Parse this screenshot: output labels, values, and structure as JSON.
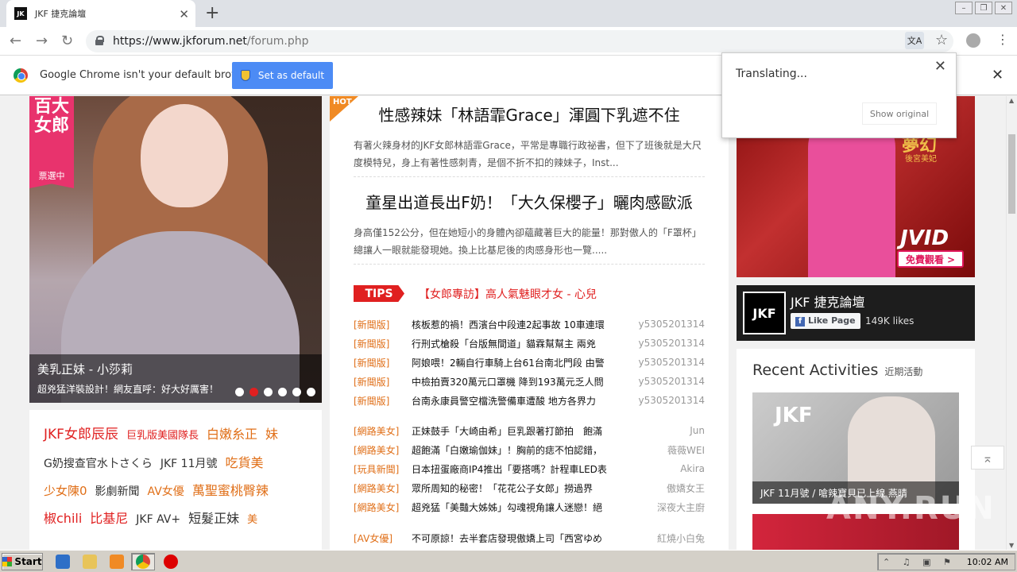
{
  "browser": {
    "tab_title": "JKF 捷克論壇",
    "favicon_text": "JK",
    "url_host": "https://www.jkforum.net",
    "url_path": "/forum.php",
    "infobar_text": "Google Chrome isn't your default browser",
    "set_default_label": "Set as default"
  },
  "translate_popup": {
    "status": "Translating...",
    "show_original": "Show original"
  },
  "hero": {
    "badge": "百大女郎",
    "badge_sub": "票選中",
    "title": "美乳正妹 - 小莎莉",
    "subtitle": "超兇猛洋裝設計！網友直呼：好大好厲害！",
    "slide_count": 6,
    "active_slide": 2
  },
  "tags": [
    {
      "text": "JKF女郎辰辰",
      "color": "#e02020",
      "size": 17
    },
    {
      "text": "巨乳版美國隊長",
      "color": "#e02020",
      "size": 13
    },
    {
      "text": "白嫩糸正",
      "color": "#e06f18",
      "size": 16
    },
    {
      "text": "妹",
      "color": "#e06f18",
      "size": 16
    },
    {
      "text": "G奶搜查官水卜さくら",
      "color": "#333333",
      "size": 14
    },
    {
      "text": "JKF 11月號",
      "color": "#333333",
      "size": 14
    },
    {
      "text": "吃貨美",
      "color": "#e06f18",
      "size": 16
    },
    {
      "text": "少女陳0",
      "color": "#e06f18",
      "size": 15
    },
    {
      "text": "影劇新聞",
      "color": "#333333",
      "size": 14
    },
    {
      "text": "AV女優",
      "color": "#e06f18",
      "size": 14
    },
    {
      "text": "萬聖蜜桃臀辣",
      "color": "#e06f18",
      "size": 16
    },
    {
      "text": "椒chili",
      "color": "#e02020",
      "size": 16
    },
    {
      "text": "比基尼",
      "color": "#e02020",
      "size": 16
    },
    {
      "text": "JKF AV+",
      "color": "#333333",
      "size": 14
    },
    {
      "text": "短髮正妹",
      "color": "#333333",
      "size": 16
    },
    {
      "text": "美",
      "color": "#e06f18",
      "size": 13
    }
  ],
  "hot_badge": "HOT",
  "articles": [
    {
      "title": "性感辣妹「林語霏Grace」渾圓下乳遮不住",
      "body": "有著火辣身材的JKF女郎林語霏Grace，平常是專職行政祕書，但下了班後就是大尺度模特兒，身上有著性感刺青，是個不折不扣的辣妹子，Inst..."
    },
    {
      "title": "童星出道長出F奶！「大久保櫻子」曬肉感歐派",
      "body": "身高僅152公分，但在她短小的身體內卻蘊藏著巨大的能量！那對傲人的「F罩杯」總讓人一眼就能發現她。換上比基尼後的肉感身形也一覽....."
    }
  ],
  "tips": {
    "label": "TIPS",
    "link": "【女郎專訪】高人氣魅眼才女 - 心兒"
  },
  "news_list": [
    {
      "cat": "[新聞版]",
      "title": "核板惹的禍！西濱台中段連2起事故 10車連環",
      "author": "y5305201314"
    },
    {
      "cat": "[新聞版]",
      "title": "行刑式槍殺「台版無間道」貓霖幫幫主 兩兇",
      "author": "y5305201314"
    },
    {
      "cat": "[新聞版]",
      "title": "阿娘喂！2輛自行車騎上台61台南北門段 由警",
      "author": "y5305201314"
    },
    {
      "cat": "[新聞版]",
      "title": "中檢拍賣320萬元口罩機 降到193萬元乏人問",
      "author": "y5305201314"
    },
    {
      "cat": "[新聞版]",
      "title": "台南永康員警空檔洗警備車遭酸 地方各界力",
      "author": "y5305201314"
    }
  ],
  "beauty_list": [
    {
      "cat": "[網路美女]",
      "title": "正妹鼓手「大崎由希」巨乳跟著打節拍　飽滿",
      "author": "Jun"
    },
    {
      "cat": "[網路美女]",
      "title": "超飽滿「白嫩瑜伽妹」！胸前的痣不怕認錯，",
      "author": "薇薇WEI"
    },
    {
      "cat": "[玩具新聞]",
      "title": "日本扭蛋廠商IP4推出「要搭嗎？計程車LED表",
      "author": "Akira"
    },
    {
      "cat": "[網路美女]",
      "title": "眾所周知的秘密！「花花公子女郎」撈過界",
      "author": "傲嬌女王"
    },
    {
      "cat": "[網路美女]",
      "title": "超兇猛「美豔大姊姊」勾魂視角讓人迷戀！絕",
      "author": "深夜大主廚"
    }
  ],
  "av_list": [
    {
      "cat": "[AV女優]",
      "title": "不可原諒！去半套店發現傲嬌上司「西宮ゆめ",
      "author": "紅燒小白兔"
    }
  ],
  "right_ad": {
    "gold_title": "夢幻",
    "gold_sub": "後宮美妃",
    "brand": "JVID",
    "cta": "免費觀看 >"
  },
  "facebook": {
    "logo": "JKF",
    "page_name": "JKF 捷克論壇",
    "like_label": "Like Page",
    "likes": "149K likes"
  },
  "recent": {
    "heading": "Recent Activities",
    "heading_zh": "近期活動",
    "card_brand": "JKF",
    "card_caption": "JKF 11月號 / 嗆辣寶貝已上線 燕晴"
  },
  "watermark": "ANY.RUN",
  "taskbar": {
    "start_label": "Start",
    "time": "10:02 AM"
  }
}
